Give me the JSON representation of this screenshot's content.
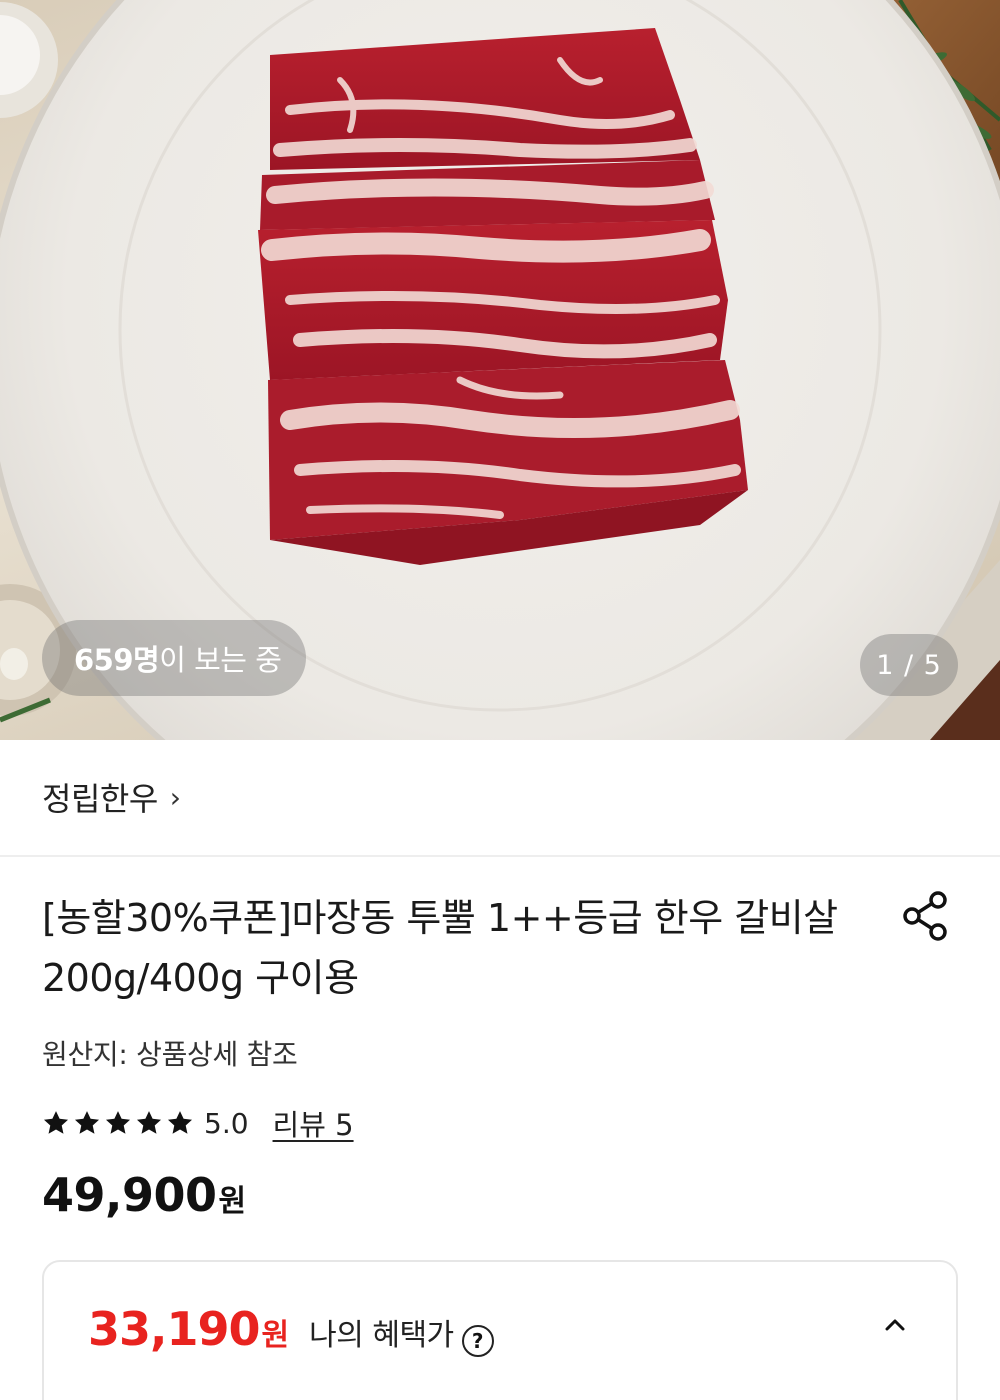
{
  "hero": {
    "viewers_count": "659명",
    "viewers_suffix": "이 보는 중",
    "pager": "1 / 5"
  },
  "brand": {
    "name": "정립한우",
    "chevron": "›"
  },
  "product": {
    "title": "[농할30%쿠폰]마장동 투뿔 1++등급 한우 갈비살 200g/400g 구이용",
    "origin": "원산지: 상품상세 참조",
    "rating_value": 5.0,
    "rating_text": "5.0",
    "review_link": "리뷰 5",
    "price": "49,900",
    "price_unit": "원"
  },
  "benefit": {
    "price": "33,190",
    "price_unit": "원",
    "label": "나의 혜택가",
    "help": "?",
    "accent_color": "#e8231f"
  },
  "icons": {
    "share": "share-icon",
    "help": "question-circle-icon",
    "expand": "chevron-up-icon",
    "star": "star-icon"
  }
}
